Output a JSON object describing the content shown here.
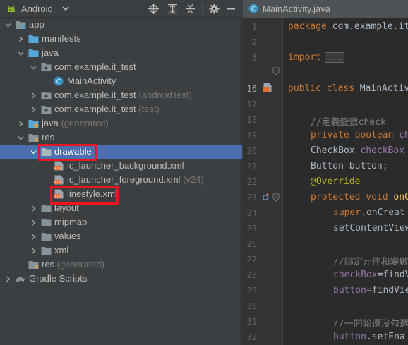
{
  "toolbar": {
    "title": "Android",
    "view_icon": "android-icon",
    "buttons": [
      "crosshair-icon",
      "expand-all-icon",
      "collapse-all-icon",
      "gear-icon",
      "hide-icon"
    ]
  },
  "tree": {
    "app": "app",
    "manifests": "manifests",
    "java": "java",
    "pkg_main": "com.example.it_test",
    "main_activity": "MainActivity",
    "pkg_android_test": "com.example.it_test",
    "pkg_android_test_suffix": "(androidTest)",
    "pkg_test": "com.example.it_test",
    "pkg_test_suffix": "(test)",
    "java_generated": "java",
    "java_generated_suffix": "(generated)",
    "res": "res",
    "drawable": "drawable",
    "ic_launcher_background": "ic_launcher_background.xml",
    "ic_launcher_foreground": "ic_launcher_foreground.xml",
    "ic_launcher_foreground_suffix": "(v24)",
    "linestyle": "linestyle.xml",
    "layout": "layout",
    "mipmap": "mipmap",
    "values": "values",
    "xml": "xml",
    "res_generated": "res",
    "res_generated_suffix": "(generated)",
    "gradle_scripts": "Gradle Scripts"
  },
  "editor": {
    "tab_label": "MainActivity.java",
    "line_numbers": [
      "1",
      "2",
      "3",
      "16",
      "17",
      "18",
      "19",
      "20",
      "21",
      "22",
      "23",
      "24",
      "25",
      "26",
      "27",
      "28",
      "29",
      "30",
      "31",
      "32"
    ],
    "code": {
      "l1_kw": "package",
      "l1_rest": " com.example.it",
      "l3_kw": "import",
      "l3_fold": "...",
      "l16_kw": "public class",
      "l16_rest": " MainActivi",
      "l18_comment": "//定義變數check",
      "l19_kw": "private boolean",
      "l19_rest": " ch",
      "l20_type": "CheckBox",
      "l20_field": " checkBox",
      "l21_text": "Button button;",
      "l22_annotation": "@Override",
      "l23_kw": "protected void",
      "l23_method": " onC",
      "l24_kw": "super",
      "l24_rest": ".onCreat",
      "l25_text": "setContentView",
      "l27_comment": "//綁定元件和變數",
      "l28_field": "checkBox",
      "l28_rest": "=findV",
      "l29_field": "button",
      "l29_rest": "=findVie",
      "l31_comment": "//一開始還沒勾選",
      "l32_field": "button",
      "l32_rest": ".setEna"
    }
  },
  "colors": {
    "highlight_box": "#e8161e",
    "selection": "#4b6eaf",
    "keyword": "#cc7832",
    "comment": "#808080",
    "annotation": "#bbb529",
    "field": "#9876aa"
  }
}
